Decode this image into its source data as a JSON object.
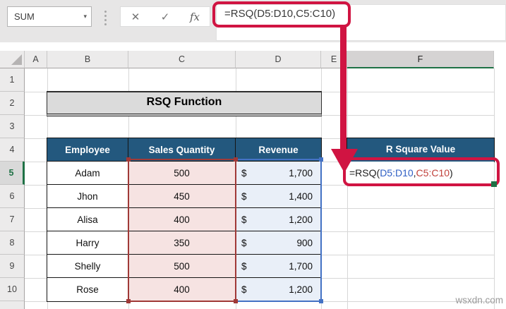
{
  "formula_bar": {
    "name_box": "SUM",
    "caret_icon": "▾",
    "cancel_icon": "✕",
    "enter_icon": "✓",
    "fx_icon": "fx",
    "formula": "=RSQ(D5:D10,C5:C10)"
  },
  "grid": {
    "column_headers": [
      "A",
      "B",
      "C",
      "D",
      "E",
      "F"
    ],
    "row_headers": [
      "1",
      "2",
      "3",
      "4",
      "5",
      "6",
      "7",
      "8",
      "9",
      "10"
    ],
    "selected_column": "F",
    "selected_row": "5"
  },
  "sheet": {
    "title": "RSQ Function",
    "table": {
      "headers": [
        "Employee",
        "Sales Quantity",
        "Revenue"
      ],
      "currency": "$",
      "rows": [
        {
          "employee": "Adam",
          "sales_quantity": "500",
          "revenue": "1,700"
        },
        {
          "employee": "Jhon",
          "sales_quantity": "450",
          "revenue": "1,400"
        },
        {
          "employee": "Alisa",
          "sales_quantity": "400",
          "revenue": "1,200"
        },
        {
          "employee": "Harry",
          "sales_quantity": "350",
          "revenue": "900"
        },
        {
          "employee": "Shelly",
          "sales_quantity": "500",
          "revenue": "1,700"
        },
        {
          "employee": "Rose",
          "sales_quantity": "400",
          "revenue": "1,200"
        }
      ]
    },
    "result": {
      "header": "R Square Value",
      "formula_parts": {
        "prefix": "=RSQ(",
        "range1": "D5:D10",
        "separator": ",",
        "range2": "C5:C10",
        "suffix": ")"
      }
    }
  },
  "colors": {
    "annotation_red": "#D01442",
    "range_red_border": "#A03937",
    "range_red_fill": "#F6E3E2",
    "range_blue_border": "#4472C4",
    "range_blue_fill": "#E9EFF8",
    "table_header_blue": "#23587E",
    "excel_green": "#1E7145",
    "ref_blue": "#2F5FC4",
    "ref_red": "#C0413B"
  },
  "watermark": "wsxdn.com"
}
